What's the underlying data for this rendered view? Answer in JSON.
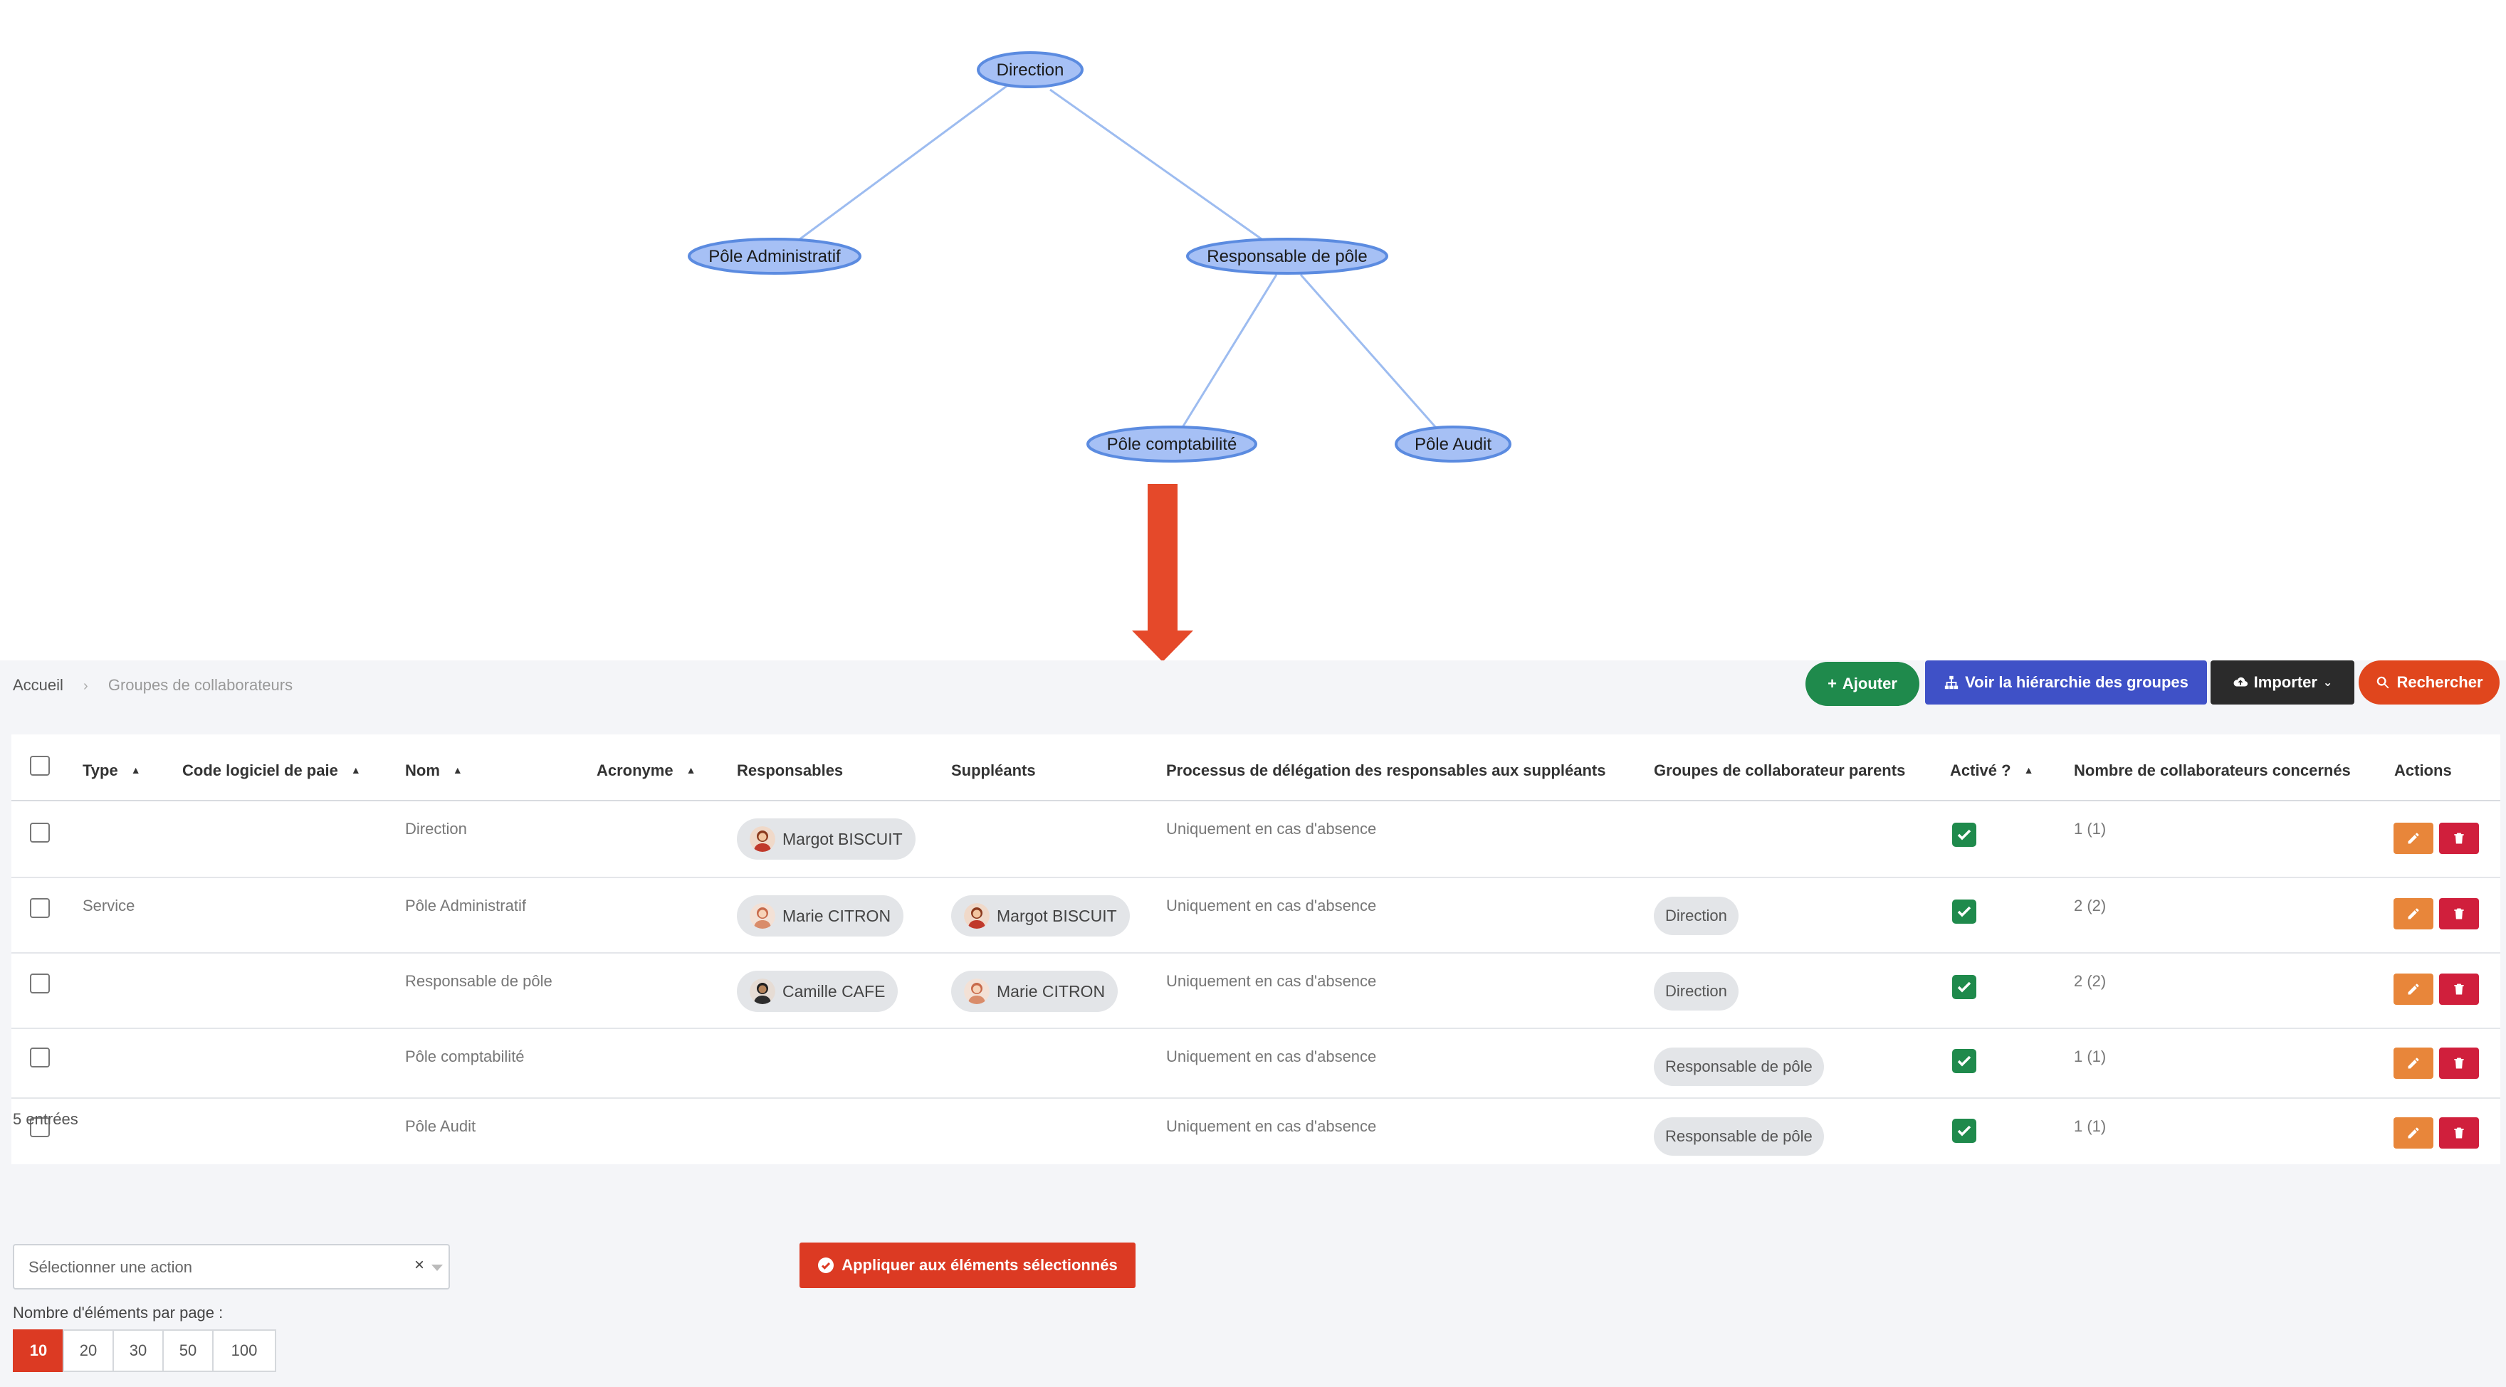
{
  "diagram": {
    "nodes": {
      "direction": "Direction",
      "pole_admin": "Pôle Administratif",
      "resp_pole": "Responsable de pôle",
      "pole_compta": "Pôle comptabilité",
      "pole_audit": "Pôle Audit"
    },
    "edges": [
      [
        "Direction",
        "Pôle Administratif"
      ],
      [
        "Direction",
        "Responsable de pôle"
      ],
      [
        "Responsable de pôle",
        "Pôle comptabilité"
      ],
      [
        "Responsable de pôle",
        "Pôle Audit"
      ]
    ],
    "arrow_color": "#e5492a"
  },
  "breadcrumb": {
    "home": "Accueil",
    "current": "Groupes de collaborateurs"
  },
  "toolbar": {
    "add": "Ajouter",
    "hierarchy": "Voir la hiérarchie des groupes",
    "import": "Importer",
    "search": "Rechercher"
  },
  "table": {
    "headers": {
      "type": "Type",
      "code": "Code logiciel de paie",
      "nom": "Nom",
      "acronyme": "Acronyme",
      "responsables": "Responsables",
      "suppleants": "Suppléants",
      "processus": "Processus de délégation des responsables aux suppléants",
      "groupes": "Groupes de collaborateur parents",
      "active": "Activé ?",
      "nombre": "Nombre de collaborateurs concernés",
      "actions": "Actions"
    },
    "rows": [
      {
        "type": "",
        "nom": "Direction",
        "responsable": "Margot BISCUIT",
        "suppleant": "",
        "processus": "Uniquement en cas d'absence",
        "groupe": "",
        "active": true,
        "nombre": "1 (1)"
      },
      {
        "type": "Service",
        "nom": "Pôle Administratif",
        "responsable": "Marie CITRON",
        "suppleant": "Margot BISCUIT",
        "processus": "Uniquement en cas d'absence",
        "groupe": "Direction",
        "active": true,
        "nombre": "2 (2)"
      },
      {
        "type": "",
        "nom": "Responsable de pôle",
        "responsable": "Camille CAFE",
        "suppleant": "Marie CITRON",
        "processus": "Uniquement en cas d'absence",
        "groupe": "Direction",
        "active": true,
        "nombre": "2 (2)"
      },
      {
        "type": "",
        "nom": "Pôle comptabilité",
        "responsable": "",
        "suppleant": "",
        "processus": "Uniquement en cas d'absence",
        "groupe": "Responsable de pôle",
        "active": true,
        "nombre": "1 (1)"
      },
      {
        "type": "",
        "nom": "Pôle Audit",
        "responsable": "",
        "suppleant": "",
        "processus": "Uniquement en cas d'absence",
        "groupe": "Responsable de pôle",
        "active": true,
        "nombre": "1 (1)"
      }
    ],
    "entries": "5 entrées"
  },
  "bulk": {
    "placeholder": "Sélectionner une action",
    "clear": "×",
    "apply": "Appliquer aux éléments sélectionnés"
  },
  "pagination": {
    "label": "Nombre d'éléments par page :",
    "options": [
      "10",
      "20",
      "30",
      "50",
      "100"
    ],
    "active": "10"
  }
}
